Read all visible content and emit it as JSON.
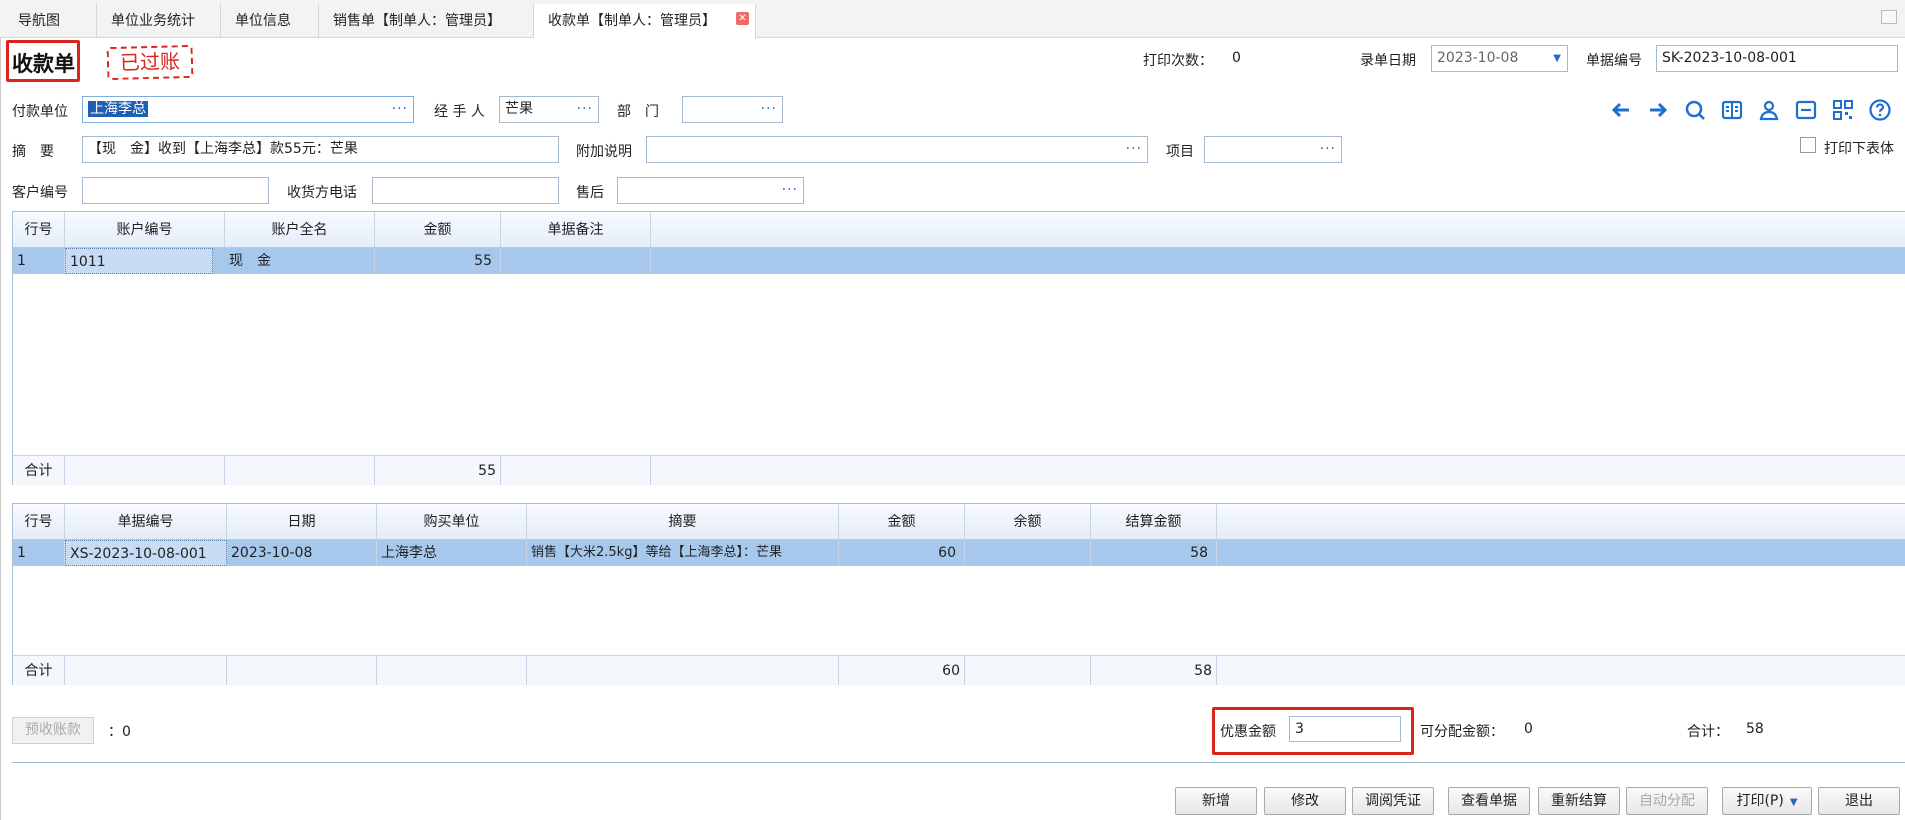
{
  "tabs": [
    {
      "label": "导航图"
    },
    {
      "label": "单位业务统计"
    },
    {
      "label": "单位信息"
    },
    {
      "label": "销售单【制单人：管理员】"
    },
    {
      "label": "收款单【制单人：管理员】"
    }
  ],
  "header": {
    "title": "收款单",
    "stamp": "已过账",
    "print_count_label": "打印次数：",
    "print_count": "0",
    "entry_date_label": "录单日期",
    "entry_date": "2023-10-08",
    "doc_no_label": "单据编号",
    "doc_no": "SK-2023-10-08-001"
  },
  "form": {
    "payer_label": "付款单位",
    "payer": "上海李总",
    "handler_label": "经 手 人",
    "handler": "芒果",
    "dept_label": "部　门",
    "dept": "",
    "summary_label": "摘　要",
    "summary": "【现　金】收到【上海李总】款55元：芒果",
    "extra_label": "附加说明",
    "extra": "",
    "project_label": "项目",
    "project": "",
    "print_table_label": "打印下表体",
    "customer_no_label": "客户编号",
    "customer_no": "",
    "phone_label": "收货方电话",
    "phone": "",
    "aftersale_label": "售后",
    "aftersale": ""
  },
  "accounts": {
    "columns": [
      "行号",
      "账户编号",
      "账户全名",
      "金额",
      "单据备注"
    ],
    "rows": [
      {
        "no": "1",
        "code": "1011",
        "name": "现　金",
        "amount": "55",
        "note": ""
      }
    ],
    "total_label": "合计",
    "total_amount": "55"
  },
  "bills": {
    "columns": [
      "行号",
      "单据编号",
      "日期",
      "购买单位",
      "摘要",
      "金额",
      "余额",
      "结算金额"
    ],
    "rows": [
      {
        "no": "1",
        "doc_no": "XS-2023-10-08-001",
        "date": "2023-10-08",
        "buyer": "上海李总",
        "summary": "销售【大米2.5kg】等给【上海李总】：芒果",
        "amount": "60",
        "balance": "",
        "settle": "58"
      }
    ],
    "total_label": "合计",
    "total_amount": "60",
    "total_settle": "58"
  },
  "bottom": {
    "prepaid_button": "预收账款",
    "prepaid_value": "：0",
    "discount_label": "优惠金额",
    "discount_value": "3",
    "allocatable_label": "可分配金额：",
    "allocatable_value": "0",
    "sum_label": "合计：",
    "sum_value": "58"
  },
  "buttons": {
    "new": "新增",
    "edit": "修改",
    "voucher": "调阅凭证",
    "view": "查看单据",
    "resettle": "重新结算",
    "auto": "自动分配",
    "print": "打印(P)",
    "exit": "退出"
  },
  "icons": [
    "arrow-left-icon",
    "arrow-right-icon",
    "search-icon",
    "book-icon",
    "user-icon",
    "folder-icon",
    "qrcode-icon",
    "help-icon"
  ],
  "colors": {
    "accent": "#1f6fd0",
    "highlight": "#d9261c",
    "row_selected": "#a6c8ec"
  }
}
